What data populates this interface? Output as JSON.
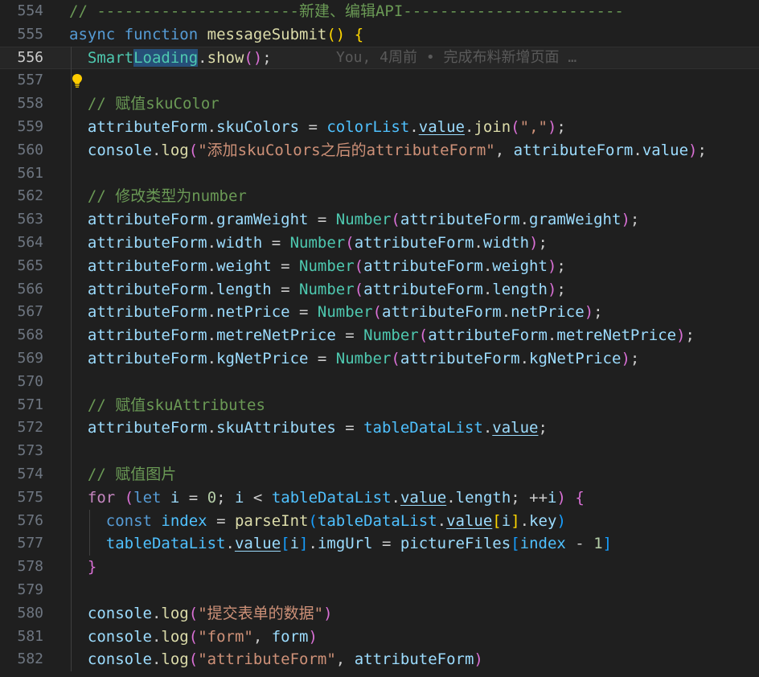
{
  "editor": {
    "code_lens": "You, 4周前 • 完成布料新增页面 …",
    "lines": [
      {
        "num": "554",
        "segs": [
          {
            "t": "// ----------------------新建、编辑API------------------------",
            "c": "cmt"
          }
        ]
      },
      {
        "num": "555",
        "segs": [
          {
            "t": "async",
            "c": "kw"
          },
          {
            "t": " "
          },
          {
            "t": "function",
            "c": "kw"
          },
          {
            "t": " "
          },
          {
            "t": "messageSubmit",
            "c": "fn"
          },
          {
            "t": "()",
            "c": "b1"
          },
          {
            "t": " "
          },
          {
            "t": "{",
            "c": "b1"
          }
        ]
      },
      {
        "num": "556",
        "active": true,
        "lens": true,
        "segs": [
          {
            "t": "  "
          },
          {
            "t": "Smart",
            "c": "cls"
          },
          {
            "t": "Loading",
            "c": "cls",
            "hl": true
          },
          {
            "t": "."
          },
          {
            "t": "show",
            "c": "fn"
          },
          {
            "t": "()",
            "c": "b2"
          },
          {
            "t": ";"
          }
        ]
      },
      {
        "num": "557",
        "bulb": true,
        "segs": []
      },
      {
        "num": "558",
        "segs": [
          {
            "t": "  "
          },
          {
            "t": "// 赋值skuColor",
            "c": "cmt"
          }
        ]
      },
      {
        "num": "559",
        "segs": [
          {
            "t": "  "
          },
          {
            "t": "attributeForm",
            "c": "var"
          },
          {
            "t": "."
          },
          {
            "t": "skuColors",
            "c": "var"
          },
          {
            "t": " = "
          },
          {
            "t": "colorList",
            "c": "con"
          },
          {
            "t": "."
          },
          {
            "t": "value",
            "c": "var",
            "u": true
          },
          {
            "t": "."
          },
          {
            "t": "join",
            "c": "fn"
          },
          {
            "t": "(",
            "c": "b2"
          },
          {
            "t": "\",\"",
            "c": "str"
          },
          {
            "t": ")",
            "c": "b2"
          },
          {
            "t": ";"
          }
        ]
      },
      {
        "num": "560",
        "segs": [
          {
            "t": "  "
          },
          {
            "t": "console",
            "c": "var"
          },
          {
            "t": "."
          },
          {
            "t": "log",
            "c": "fn"
          },
          {
            "t": "(",
            "c": "b2"
          },
          {
            "t": "\"添加skuColors之后的attributeForm\"",
            "c": "str"
          },
          {
            "t": ", "
          },
          {
            "t": "attributeForm",
            "c": "var"
          },
          {
            "t": "."
          },
          {
            "t": "value",
            "c": "var"
          },
          {
            "t": ")",
            "c": "b2"
          },
          {
            "t": ";"
          }
        ]
      },
      {
        "num": "561",
        "segs": []
      },
      {
        "num": "562",
        "segs": [
          {
            "t": "  "
          },
          {
            "t": "// 修改类型为number",
            "c": "cmt"
          }
        ]
      },
      {
        "num": "563",
        "segs": [
          {
            "t": "  "
          },
          {
            "t": "attributeForm",
            "c": "var"
          },
          {
            "t": "."
          },
          {
            "t": "gramWeight",
            "c": "var"
          },
          {
            "t": " = "
          },
          {
            "t": "Number",
            "c": "cls"
          },
          {
            "t": "(",
            "c": "b2"
          },
          {
            "t": "attributeForm",
            "c": "var"
          },
          {
            "t": "."
          },
          {
            "t": "gramWeight",
            "c": "var"
          },
          {
            "t": ")",
            "c": "b2"
          },
          {
            "t": ";"
          }
        ]
      },
      {
        "num": "564",
        "segs": [
          {
            "t": "  "
          },
          {
            "t": "attributeForm",
            "c": "var"
          },
          {
            "t": "."
          },
          {
            "t": "width",
            "c": "var"
          },
          {
            "t": " = "
          },
          {
            "t": "Number",
            "c": "cls"
          },
          {
            "t": "(",
            "c": "b2"
          },
          {
            "t": "attributeForm",
            "c": "var"
          },
          {
            "t": "."
          },
          {
            "t": "width",
            "c": "var"
          },
          {
            "t": ")",
            "c": "b2"
          },
          {
            "t": ";"
          }
        ]
      },
      {
        "num": "565",
        "segs": [
          {
            "t": "  "
          },
          {
            "t": "attributeForm",
            "c": "var"
          },
          {
            "t": "."
          },
          {
            "t": "weight",
            "c": "var"
          },
          {
            "t": " = "
          },
          {
            "t": "Number",
            "c": "cls"
          },
          {
            "t": "(",
            "c": "b2"
          },
          {
            "t": "attributeForm",
            "c": "var"
          },
          {
            "t": "."
          },
          {
            "t": "weight",
            "c": "var"
          },
          {
            "t": ")",
            "c": "b2"
          },
          {
            "t": ";"
          }
        ]
      },
      {
        "num": "566",
        "segs": [
          {
            "t": "  "
          },
          {
            "t": "attributeForm",
            "c": "var"
          },
          {
            "t": "."
          },
          {
            "t": "length",
            "c": "var"
          },
          {
            "t": " = "
          },
          {
            "t": "Number",
            "c": "cls"
          },
          {
            "t": "(",
            "c": "b2"
          },
          {
            "t": "attributeForm",
            "c": "var"
          },
          {
            "t": "."
          },
          {
            "t": "length",
            "c": "var"
          },
          {
            "t": ")",
            "c": "b2"
          },
          {
            "t": ";"
          }
        ]
      },
      {
        "num": "567",
        "segs": [
          {
            "t": "  "
          },
          {
            "t": "attributeForm",
            "c": "var"
          },
          {
            "t": "."
          },
          {
            "t": "netPrice",
            "c": "var"
          },
          {
            "t": " = "
          },
          {
            "t": "Number",
            "c": "cls"
          },
          {
            "t": "(",
            "c": "b2"
          },
          {
            "t": "attributeForm",
            "c": "var"
          },
          {
            "t": "."
          },
          {
            "t": "netPrice",
            "c": "var"
          },
          {
            "t": ")",
            "c": "b2"
          },
          {
            "t": ";"
          }
        ]
      },
      {
        "num": "568",
        "segs": [
          {
            "t": "  "
          },
          {
            "t": "attributeForm",
            "c": "var"
          },
          {
            "t": "."
          },
          {
            "t": "metreNetPrice",
            "c": "var"
          },
          {
            "t": " = "
          },
          {
            "t": "Number",
            "c": "cls"
          },
          {
            "t": "(",
            "c": "b2"
          },
          {
            "t": "attributeForm",
            "c": "var"
          },
          {
            "t": "."
          },
          {
            "t": "metreNetPrice",
            "c": "var"
          },
          {
            "t": ")",
            "c": "b2"
          },
          {
            "t": ";"
          }
        ]
      },
      {
        "num": "569",
        "segs": [
          {
            "t": "  "
          },
          {
            "t": "attributeForm",
            "c": "var"
          },
          {
            "t": "."
          },
          {
            "t": "kgNetPrice",
            "c": "var"
          },
          {
            "t": " = "
          },
          {
            "t": "Number",
            "c": "cls"
          },
          {
            "t": "(",
            "c": "b2"
          },
          {
            "t": "attributeForm",
            "c": "var"
          },
          {
            "t": "."
          },
          {
            "t": "kgNetPrice",
            "c": "var"
          },
          {
            "t": ")",
            "c": "b2"
          },
          {
            "t": ";"
          }
        ]
      },
      {
        "num": "570",
        "segs": []
      },
      {
        "num": "571",
        "segs": [
          {
            "t": "  "
          },
          {
            "t": "// 赋值skuAttributes",
            "c": "cmt"
          }
        ]
      },
      {
        "num": "572",
        "segs": [
          {
            "t": "  "
          },
          {
            "t": "attributeForm",
            "c": "var"
          },
          {
            "t": "."
          },
          {
            "t": "skuAttributes",
            "c": "var"
          },
          {
            "t": " = "
          },
          {
            "t": "tableDataList",
            "c": "con"
          },
          {
            "t": "."
          },
          {
            "t": "value",
            "c": "var",
            "u": true
          },
          {
            "t": ";"
          }
        ]
      },
      {
        "num": "573",
        "segs": []
      },
      {
        "num": "574",
        "segs": [
          {
            "t": "  "
          },
          {
            "t": "// 赋值图片",
            "c": "cmt"
          }
        ]
      },
      {
        "num": "575",
        "segs": [
          {
            "t": "  "
          },
          {
            "t": "for",
            "c": "kw2"
          },
          {
            "t": " "
          },
          {
            "t": "(",
            "c": "b2"
          },
          {
            "t": "let",
            "c": "kw"
          },
          {
            "t": " "
          },
          {
            "t": "i",
            "c": "var"
          },
          {
            "t": " = "
          },
          {
            "t": "0",
            "c": "num"
          },
          {
            "t": "; "
          },
          {
            "t": "i",
            "c": "var"
          },
          {
            "t": " < "
          },
          {
            "t": "tableDataList",
            "c": "con"
          },
          {
            "t": "."
          },
          {
            "t": "value",
            "c": "var",
            "u": true
          },
          {
            "t": "."
          },
          {
            "t": "length",
            "c": "var"
          },
          {
            "t": "; ++"
          },
          {
            "t": "i",
            "c": "var"
          },
          {
            "t": ")",
            "c": "b2"
          },
          {
            "t": " "
          },
          {
            "t": "{",
            "c": "b2"
          }
        ]
      },
      {
        "num": "576",
        "guide2": true,
        "segs": [
          {
            "t": "    "
          },
          {
            "t": "const",
            "c": "kw"
          },
          {
            "t": " "
          },
          {
            "t": "index",
            "c": "con"
          },
          {
            "t": " = "
          },
          {
            "t": "parseInt",
            "c": "fn"
          },
          {
            "t": "(",
            "c": "b3"
          },
          {
            "t": "tableDataList",
            "c": "con"
          },
          {
            "t": "."
          },
          {
            "t": "value",
            "c": "var",
            "u": true
          },
          {
            "t": "[",
            "c": "b1"
          },
          {
            "t": "i",
            "c": "var"
          },
          {
            "t": "]",
            "c": "b1"
          },
          {
            "t": "."
          },
          {
            "t": "key",
            "c": "var"
          },
          {
            "t": ")",
            "c": "b3"
          }
        ]
      },
      {
        "num": "577",
        "guide2": true,
        "segs": [
          {
            "t": "    "
          },
          {
            "t": "tableDataList",
            "c": "con"
          },
          {
            "t": "."
          },
          {
            "t": "value",
            "c": "var",
            "u": true
          },
          {
            "t": "[",
            "c": "b3"
          },
          {
            "t": "i",
            "c": "var"
          },
          {
            "t": "]",
            "c": "b3"
          },
          {
            "t": "."
          },
          {
            "t": "imgUrl",
            "c": "var"
          },
          {
            "t": " = "
          },
          {
            "t": "pictureFiles",
            "c": "var"
          },
          {
            "t": "[",
            "c": "b3"
          },
          {
            "t": "index",
            "c": "con"
          },
          {
            "t": " - "
          },
          {
            "t": "1",
            "c": "num"
          },
          {
            "t": "]",
            "c": "b3"
          }
        ]
      },
      {
        "num": "578",
        "segs": [
          {
            "t": "  "
          },
          {
            "t": "}",
            "c": "b2"
          }
        ]
      },
      {
        "num": "579",
        "segs": []
      },
      {
        "num": "580",
        "segs": [
          {
            "t": "  "
          },
          {
            "t": "console",
            "c": "var"
          },
          {
            "t": "."
          },
          {
            "t": "log",
            "c": "fn"
          },
          {
            "t": "(",
            "c": "b2"
          },
          {
            "t": "\"提交表单的数据\"",
            "c": "str"
          },
          {
            "t": ")",
            "c": "b2"
          }
        ]
      },
      {
        "num": "581",
        "segs": [
          {
            "t": "  "
          },
          {
            "t": "console",
            "c": "var"
          },
          {
            "t": "."
          },
          {
            "t": "log",
            "c": "fn"
          },
          {
            "t": "(",
            "c": "b2"
          },
          {
            "t": "\"form\"",
            "c": "str"
          },
          {
            "t": ", "
          },
          {
            "t": "form",
            "c": "var"
          },
          {
            "t": ")",
            "c": "b2"
          }
        ]
      },
      {
        "num": "582",
        "segs": [
          {
            "t": "  "
          },
          {
            "t": "console",
            "c": "var"
          },
          {
            "t": "."
          },
          {
            "t": "log",
            "c": "fn"
          },
          {
            "t": "(",
            "c": "b2"
          },
          {
            "t": "\"attributeForm\"",
            "c": "str"
          },
          {
            "t": ", "
          },
          {
            "t": "attributeForm",
            "c": "var"
          },
          {
            "t": ")",
            "c": "b2"
          }
        ]
      }
    ]
  }
}
